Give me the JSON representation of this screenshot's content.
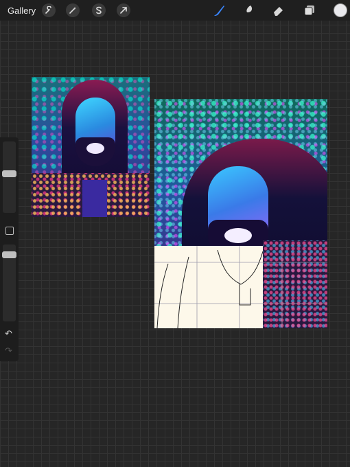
{
  "toolbar": {
    "gallery_label": "Gallery",
    "left_tools": [
      {
        "name": "actions-wrench-icon"
      },
      {
        "name": "adjustments-wand-icon"
      },
      {
        "name": "selection-s-icon"
      },
      {
        "name": "transform-arrow-icon"
      }
    ],
    "right_tools": [
      {
        "name": "brush-icon",
        "active": true
      },
      {
        "name": "smudge-icon"
      },
      {
        "name": "eraser-icon"
      },
      {
        "name": "layers-icon"
      }
    ],
    "current_color": "#e8e8ec",
    "accent_color": "#3a86ff"
  },
  "sidebar": {
    "brush_size": 0.55,
    "opacity": 0.9,
    "undo_icon": "undo-icon",
    "redo_icon": "redo-icon"
  }
}
